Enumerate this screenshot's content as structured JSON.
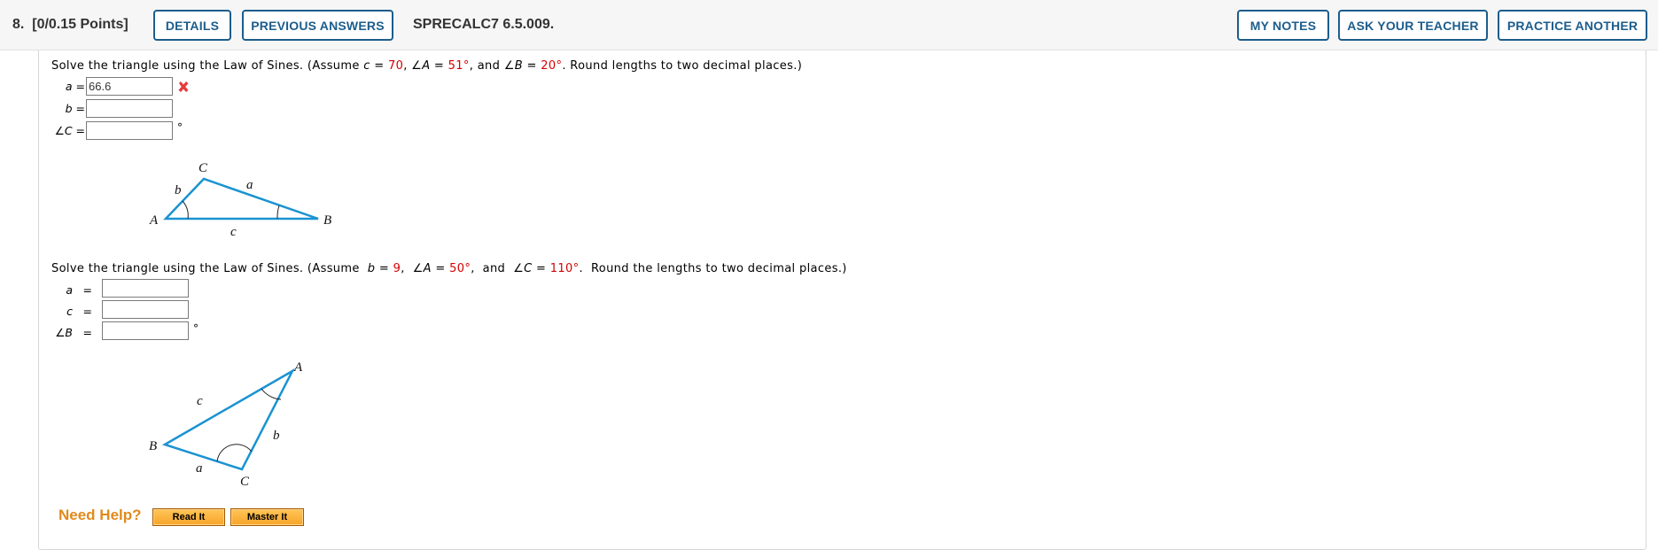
{
  "header": {
    "question_number": "8.",
    "points": "[0/0.15 Points]",
    "details_label": "DETAILS",
    "previous_answers_label": "PREVIOUS ANSWERS",
    "problem_code": "SPRECALC7 6.5.009.",
    "my_notes_label": "MY NOTES",
    "ask_teacher_label": "ASK YOUR TEACHER",
    "practice_another_label": "PRACTICE ANOTHER"
  },
  "part1": {
    "prompt_prefix": "Solve the triangle using the Law of Sines. (Assume ",
    "c_var": "c",
    "eq1": " = ",
    "c_value": "70",
    "sep1": ", ∠",
    "A_var": "A",
    "eq2": " = ",
    "A_value": "51°",
    "sep2": ", and ∠",
    "B_var": "B",
    "eq3": " = ",
    "B_value": "20°",
    "prompt_suffix": ". Round lengths to two decimal places.)",
    "fields": [
      {
        "label": "a =",
        "value": "66.6",
        "status": "incorrect",
        "unit": ""
      },
      {
        "label": "b =",
        "value": "",
        "status": "",
        "unit": ""
      },
      {
        "label": "∠C =",
        "value": "",
        "status": "",
        "unit": "°"
      }
    ],
    "diagram": {
      "vertices": {
        "A": "A",
        "B": "B",
        "C": "C"
      },
      "sides": {
        "a": "a",
        "b": "b",
        "c": "c"
      }
    }
  },
  "part2": {
    "prompt_prefix": "Solve the triangle using the Law of Sines. (Assume  ",
    "b_var": "b",
    "eq1": " = ",
    "b_value": "9",
    "sep1": ",  ∠",
    "A_var": "A",
    "eq2": " = ",
    "A_value": "50°",
    "sep2": ",  and  ∠",
    "C_var": "C",
    "eq3": " = ",
    "C_value": "110°",
    "prompt_suffix": ".  Round the lengths to two decimal places.)",
    "fields": [
      {
        "label": "a",
        "eq": "=",
        "value": "",
        "unit": ""
      },
      {
        "label": "c",
        "eq": "=",
        "value": "",
        "unit": ""
      },
      {
        "label": "∠B",
        "eq": "=",
        "value": "",
        "unit": "°"
      }
    ],
    "diagram": {
      "vertices": {
        "A": "A",
        "B": "B",
        "C": "C"
      },
      "sides": {
        "a": "a",
        "b": "b",
        "c": "c"
      }
    }
  },
  "help": {
    "label": "Need Help?",
    "read_it_label": "Read It",
    "master_it_label": "Master It"
  },
  "colors": {
    "accent_blue": "#1c5d8c",
    "given_value_red": "#d60000",
    "triangle_blue": "#1a93d2",
    "help_orange": "#e08a1e"
  }
}
